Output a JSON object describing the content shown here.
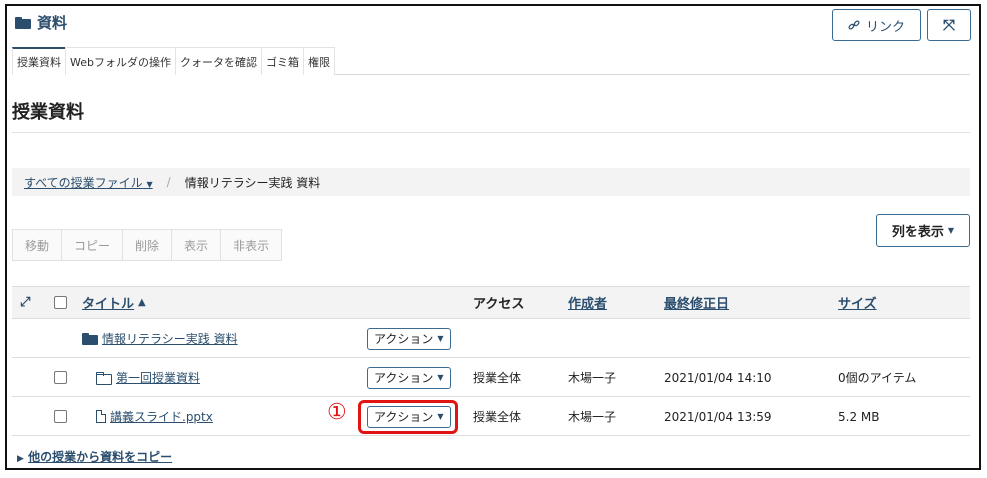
{
  "header": {
    "title": "資料",
    "link_label": "リンク"
  },
  "tabs": [
    "授業資料",
    "Webフォルダの操作",
    "クォータを確認",
    "ゴミ箱",
    "権限"
  ],
  "page_title": "授業資料",
  "breadcrumb": {
    "root": "すべての授業ファイル",
    "current": "情報リテラシー実践 資料"
  },
  "toolbar": {
    "buttons": [
      "移動",
      "コピー",
      "削除",
      "表示",
      "非表示"
    ],
    "columns_label": "列を表示"
  },
  "table": {
    "headers": {
      "title": "タイトル",
      "access": "アクセス",
      "creator": "作成者",
      "modified": "最終修正日",
      "size": "サイズ"
    },
    "rows": [
      {
        "title": "情報リテラシー実践 資料",
        "action": "アクション",
        "access": "",
        "creator": "",
        "modified": "",
        "size": ""
      },
      {
        "title": "第一回授業資料",
        "action": "アクション",
        "access": "授業全体",
        "creator": "木場一子",
        "modified": "2021/01/04 14:10",
        "size": "0個のアイテム"
      },
      {
        "title": "講義スライド.pptx",
        "action": "アクション",
        "access": "授業全体",
        "creator": "木場一子",
        "modified": "2021/01/04 13:59",
        "size": "5.2 MB"
      }
    ]
  },
  "annotation": "①",
  "footer_link": "他の授業から資料をコピー",
  "colors": {
    "accent": "#2b4e6e",
    "highlight": "#e11414"
  }
}
